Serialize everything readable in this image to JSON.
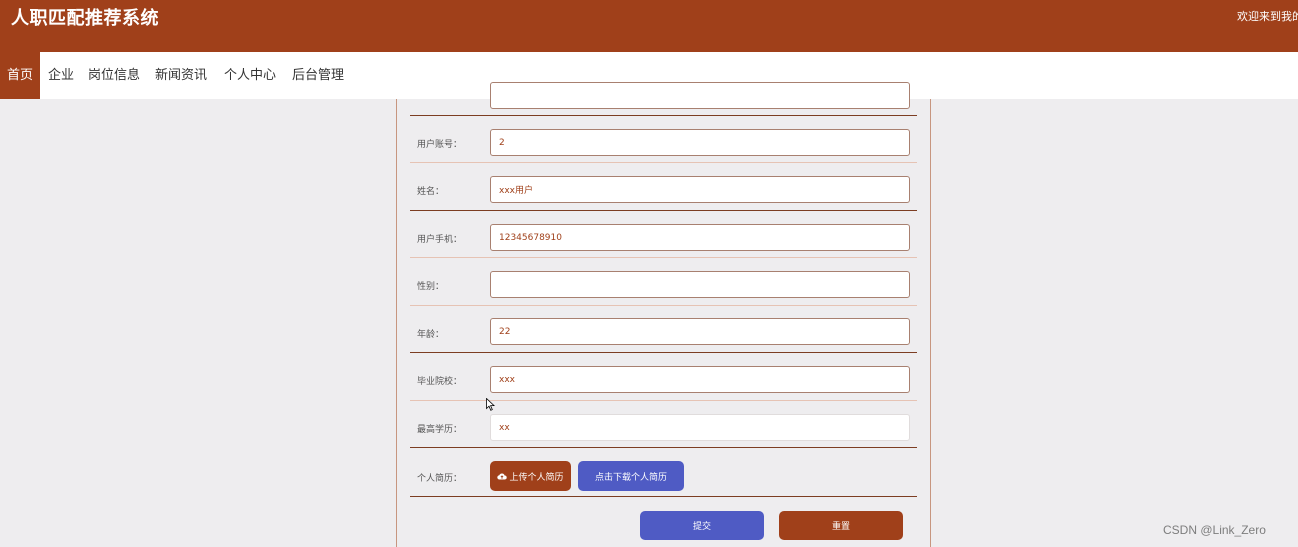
{
  "header": {
    "site_title": "人职匹配推荐系统",
    "welcome_text": "欢迎来到我的"
  },
  "nav": {
    "items": [
      "首页",
      "企业",
      "岗位信息",
      "新闻资讯",
      "个人中心",
      "后台管理"
    ],
    "active_index": 0
  },
  "form": {
    "fields": [
      {
        "label": "用户账号：",
        "value": "2"
      },
      {
        "label": "姓名：",
        "value": "xxx用户"
      },
      {
        "label": "用户手机：",
        "value": "12345678910"
      },
      {
        "label": "性别：",
        "value": ""
      },
      {
        "label": "年龄：",
        "value": "22"
      },
      {
        "label": "毕业院校：",
        "value": "xxx"
      },
      {
        "label": "最高学历：",
        "value": "xx"
      }
    ],
    "resume_label": "个人简历：",
    "upload_button": "上传个人简历",
    "download_button": "点击下载个人简历",
    "submit_button": "提交",
    "reset_button": "重置"
  },
  "watermark": "CSDN @Link_Zero",
  "colors": {
    "brand": "#a0401a",
    "accent_blue": "#4f5bc4",
    "page_bg": "#eeedef"
  },
  "icons": {
    "upload": "cloud-upload-icon",
    "cursor": "mouse-pointer-icon"
  }
}
